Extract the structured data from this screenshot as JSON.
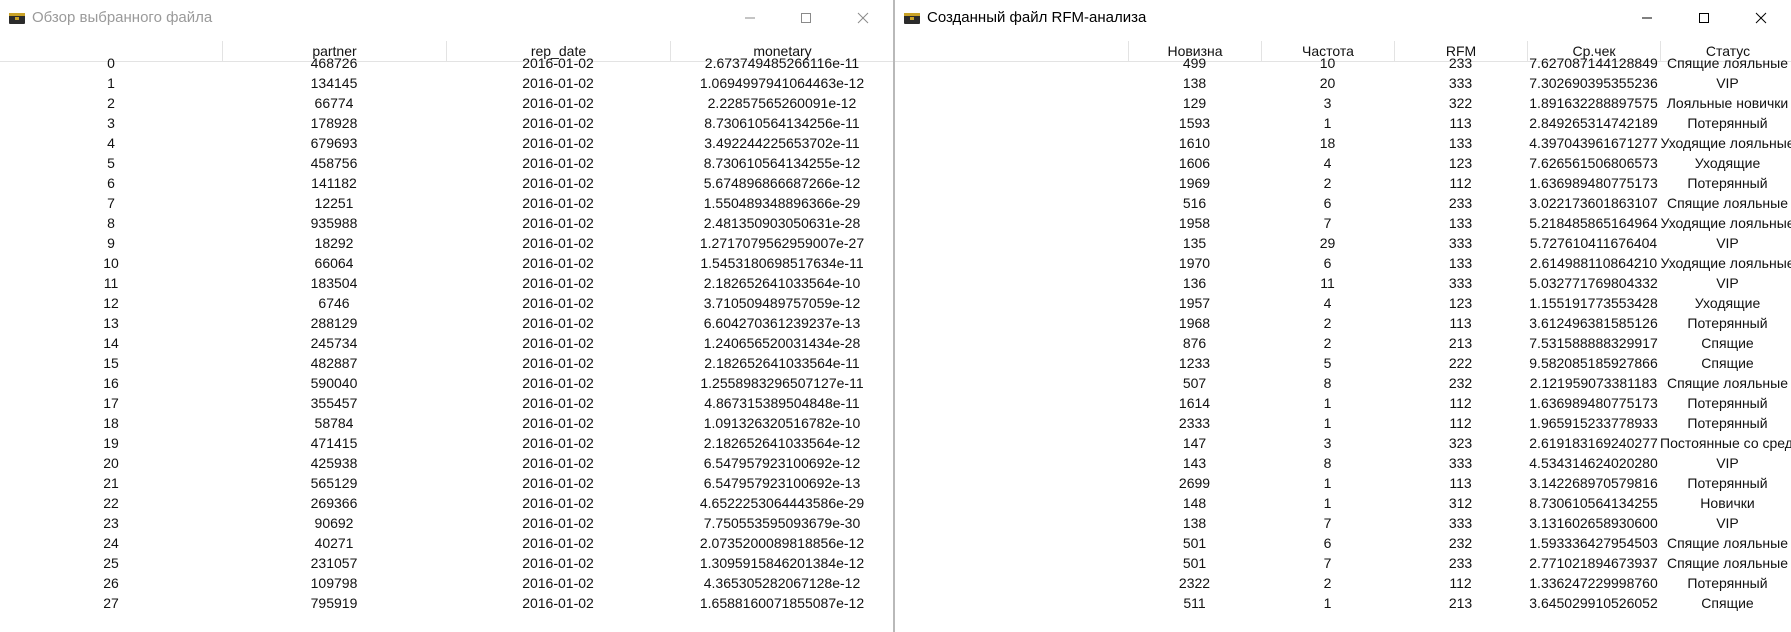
{
  "left_window": {
    "title": "Обзор выбранного файла",
    "columns": [
      "",
      "partner",
      "rep_date",
      "monetary"
    ],
    "rows": [
      [
        "0",
        "468726",
        "2016-01-02",
        "2.673749485266116e-11"
      ],
      [
        "1",
        "134145",
        "2016-01-02",
        "1.0694997941064463e-12"
      ],
      [
        "2",
        "66774",
        "2016-01-02",
        "2.22857565260091e-12"
      ],
      [
        "3",
        "178928",
        "2016-01-02",
        "8.730610564134256e-11"
      ],
      [
        "4",
        "679693",
        "2016-01-02",
        "3.492244225653702e-11"
      ],
      [
        "5",
        "458756",
        "2016-01-02",
        "8.730610564134255e-12"
      ],
      [
        "6",
        "141182",
        "2016-01-02",
        "5.674896866687266e-12"
      ],
      [
        "7",
        "12251",
        "2016-01-02",
        "1.550489348896366e-29"
      ],
      [
        "8",
        "935988",
        "2016-01-02",
        "2.481350903050631e-28"
      ],
      [
        "9",
        "18292",
        "2016-01-02",
        "1.2717079562959007e-27"
      ],
      [
        "10",
        "66064",
        "2016-01-02",
        "1.5453180698517634e-11"
      ],
      [
        "11",
        "183504",
        "2016-01-02",
        "2.182652641033564e-10"
      ],
      [
        "12",
        "6746",
        "2016-01-02",
        "3.710509489757059e-12"
      ],
      [
        "13",
        "288129",
        "2016-01-02",
        "6.604270361239237e-13"
      ],
      [
        "14",
        "245734",
        "2016-01-02",
        "1.240656520031434e-28"
      ],
      [
        "15",
        "482887",
        "2016-01-02",
        "2.182652641033564e-11"
      ],
      [
        "16",
        "590040",
        "2016-01-02",
        "1.2558983296507127e-11"
      ],
      [
        "17",
        "355457",
        "2016-01-02",
        "4.867315389504848e-11"
      ],
      [
        "18",
        "58784",
        "2016-01-02",
        "1.091326320516782e-10"
      ],
      [
        "19",
        "471415",
        "2016-01-02",
        "2.182652641033564e-12"
      ],
      [
        "20",
        "425938",
        "2016-01-02",
        "6.547957923100692e-12"
      ],
      [
        "21",
        "565129",
        "2016-01-02",
        "6.547957923100692e-13"
      ],
      [
        "22",
        "269366",
        "2016-01-02",
        "4.6522253064443586e-29"
      ],
      [
        "23",
        "90692",
        "2016-01-02",
        "7.750553595093679e-30"
      ],
      [
        "24",
        "40271",
        "2016-01-02",
        "2.0735200089818856e-12"
      ],
      [
        "25",
        "231057",
        "2016-01-02",
        "1.3095915846201384e-12"
      ],
      [
        "26",
        "109798",
        "2016-01-02",
        "4.365305282067128e-12"
      ],
      [
        "27",
        "795919",
        "2016-01-02",
        "1.6588160071855087e-12"
      ]
    ]
  },
  "right_window": {
    "title": "Созданный файл RFM-анализа",
    "columns": [
      "",
      "Новизна",
      "Частота",
      "RFM",
      "Ср.чек",
      "Статус"
    ],
    "rows": [
      [
        "",
        "499",
        "10",
        "233",
        "7.627087144128849",
        "Спящие лояльные"
      ],
      [
        "",
        "138",
        "20",
        "333",
        "7.302690395355236",
        "VIP"
      ],
      [
        "",
        "129",
        "3",
        "322",
        "1.891632288897575",
        "Лояльные новички"
      ],
      [
        "",
        "1593",
        "1",
        "113",
        "2.849265314742189",
        "Потерянный"
      ],
      [
        "",
        "1610",
        "18",
        "133",
        "4.397043961671277",
        "Уходящие лояльные"
      ],
      [
        "",
        "1606",
        "4",
        "123",
        "7.626561506806573",
        "Уходящие"
      ],
      [
        "",
        "1969",
        "2",
        "112",
        "1.636989480775173",
        "Потерянный"
      ],
      [
        "",
        "516",
        "6",
        "233",
        "3.022173601863107",
        "Спящие лояльные"
      ],
      [
        "",
        "1958",
        "7",
        "133",
        "5.218485865164964",
        "Уходящие лояльные"
      ],
      [
        "",
        "135",
        "29",
        "333",
        "5.727610411676404",
        "VIP"
      ],
      [
        "",
        "1970",
        "6",
        "133",
        "2.614988110864210",
        "Уходящие лояльные"
      ],
      [
        "",
        "136",
        "11",
        "333",
        "5.032771769804332",
        "VIP"
      ],
      [
        "",
        "1957",
        "4",
        "123",
        "1.155191773553428",
        "Уходящие"
      ],
      [
        "",
        "1968",
        "2",
        "113",
        "3.612496381585126",
        "Потерянный"
      ],
      [
        "",
        "876",
        "2",
        "213",
        "7.531588888329917",
        "Спящие"
      ],
      [
        "",
        "1233",
        "5",
        "222",
        "9.582085185927866",
        "Спящие"
      ],
      [
        "",
        "507",
        "8",
        "232",
        "2.121959073381183",
        "Спящие лояльные"
      ],
      [
        "",
        "1614",
        "1",
        "112",
        "1.636989480775173",
        "Потерянный"
      ],
      [
        "",
        "2333",
        "1",
        "112",
        "1.965915233778933",
        "Потерянный"
      ],
      [
        "",
        "147",
        "3",
        "323",
        "2.619183169240277",
        "Постоянные со средним"
      ],
      [
        "",
        "143",
        "8",
        "333",
        "4.534314624020280",
        "VIP"
      ],
      [
        "",
        "2699",
        "1",
        "113",
        "3.142268970579816",
        "Потерянный"
      ],
      [
        "",
        "148",
        "1",
        "312",
        "8.730610564134255",
        "Новички"
      ],
      [
        "",
        "138",
        "7",
        "333",
        "3.131602658930600",
        "VIP"
      ],
      [
        "",
        "501",
        "6",
        "232",
        "1.593336427954503",
        "Спящие лояльные"
      ],
      [
        "",
        "501",
        "7",
        "233",
        "2.771021894673937",
        "Спящие лояльные"
      ],
      [
        "",
        "2322",
        "2",
        "112",
        "1.336247229998760",
        "Потерянный"
      ],
      [
        "",
        "511",
        "1",
        "213",
        "3.645029910526052",
        "Спящие"
      ]
    ]
  },
  "colors": {
    "divider": "#b9b9b9",
    "header_line": "#e3e3e3",
    "inactive_title": "#9a9a9a"
  },
  "icons": [
    "app-icon",
    "minimize-icon",
    "maximize-icon",
    "close-icon"
  ]
}
